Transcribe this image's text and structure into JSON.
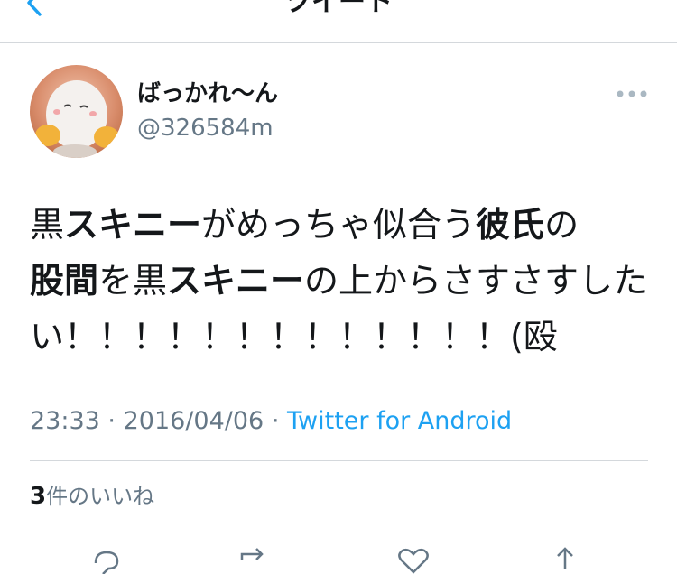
{
  "nav": {
    "title": "ツイート",
    "back_icon": "chevron-left-icon"
  },
  "user": {
    "display_name": "ばっかれ〜ん",
    "handle": "@326584m"
  },
  "tweet": {
    "segments": [
      {
        "text": "黒",
        "bold": false
      },
      {
        "text": "スキニー",
        "bold": true
      },
      {
        "text": "がめっちゃ似合う",
        "bold": false
      },
      {
        "text": "彼氏",
        "bold": true
      },
      {
        "text": "の",
        "bold": false
      },
      {
        "text": "股間",
        "bold": true
      },
      {
        "text": "を黒",
        "bold": false
      },
      {
        "text": "スキニー",
        "bold": true
      },
      {
        "text": "の上からさすさすしたい！！！！！！！！！！！！！(殴",
        "bold": false
      }
    ]
  },
  "meta": {
    "time": "23:33",
    "separator": "·",
    "date": "2016/04/06",
    "source": "Twitter for Android"
  },
  "likes": {
    "count": "3",
    "label": "件のいいね"
  },
  "colors": {
    "link": "#1da1f2",
    "secondary": "#657786",
    "divider": "#d4d8dc"
  },
  "actions": [
    {
      "name": "reply-icon"
    },
    {
      "name": "retweet-icon"
    },
    {
      "name": "like-icon"
    },
    {
      "name": "share-icon"
    }
  ]
}
